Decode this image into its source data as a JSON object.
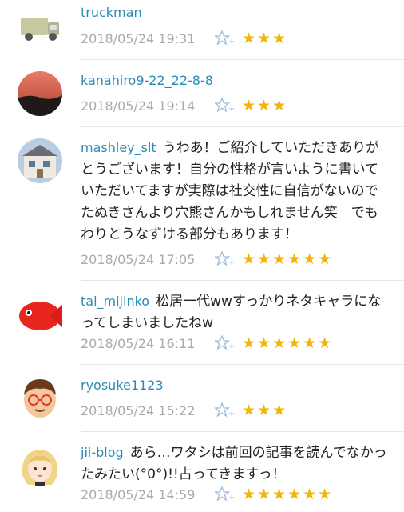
{
  "comments": [
    {
      "user": "truckman",
      "text": "",
      "date": "2018/05/24 19:31",
      "stars": "★★★",
      "avatar": "truck-avatar"
    },
    {
      "user": "kanahiro9-22_22-8-8",
      "text": "",
      "date": "2018/05/24 19:14",
      "stars": "★★★",
      "avatar": "sunset-avatar"
    },
    {
      "user": "mashley_slt",
      "text": "うわあ！ご紹介していただきありがとうございます！自分の性格が言いように書いていただいてますが実際は社交性に自信がないのでたぬきさんより穴熊さんかもしれません笑　でもわりとうなずける部分もあります！",
      "date": "2018/05/24 17:05",
      "stars": "★★★★★★",
      "avatar": "house-avatar"
    },
    {
      "user": "tai_mijinko",
      "text": "松居一代wwすっかりネタキャラになってしまいましたねw",
      "date": "2018/05/24 16:11",
      "stars": "★★★★★★",
      "avatar": "fish-avatar"
    },
    {
      "user": "ryosuke1123",
      "text": "",
      "date": "2018/05/24 15:22",
      "stars": "★★★",
      "avatar": "face-avatar"
    },
    {
      "user": "jii-blog",
      "text": "あら…ワタシは前回の記事を読んでなかったみたい(°0°)!!占ってきますっ！",
      "date": "2018/05/24 14:59",
      "stars": "★★★★★★",
      "avatar": "girl-avatar"
    }
  ],
  "colors": {
    "username": "#2a8bb7",
    "date": "#aaaaaa",
    "star": "#f4b400",
    "add_star": "#9bb8d8"
  }
}
